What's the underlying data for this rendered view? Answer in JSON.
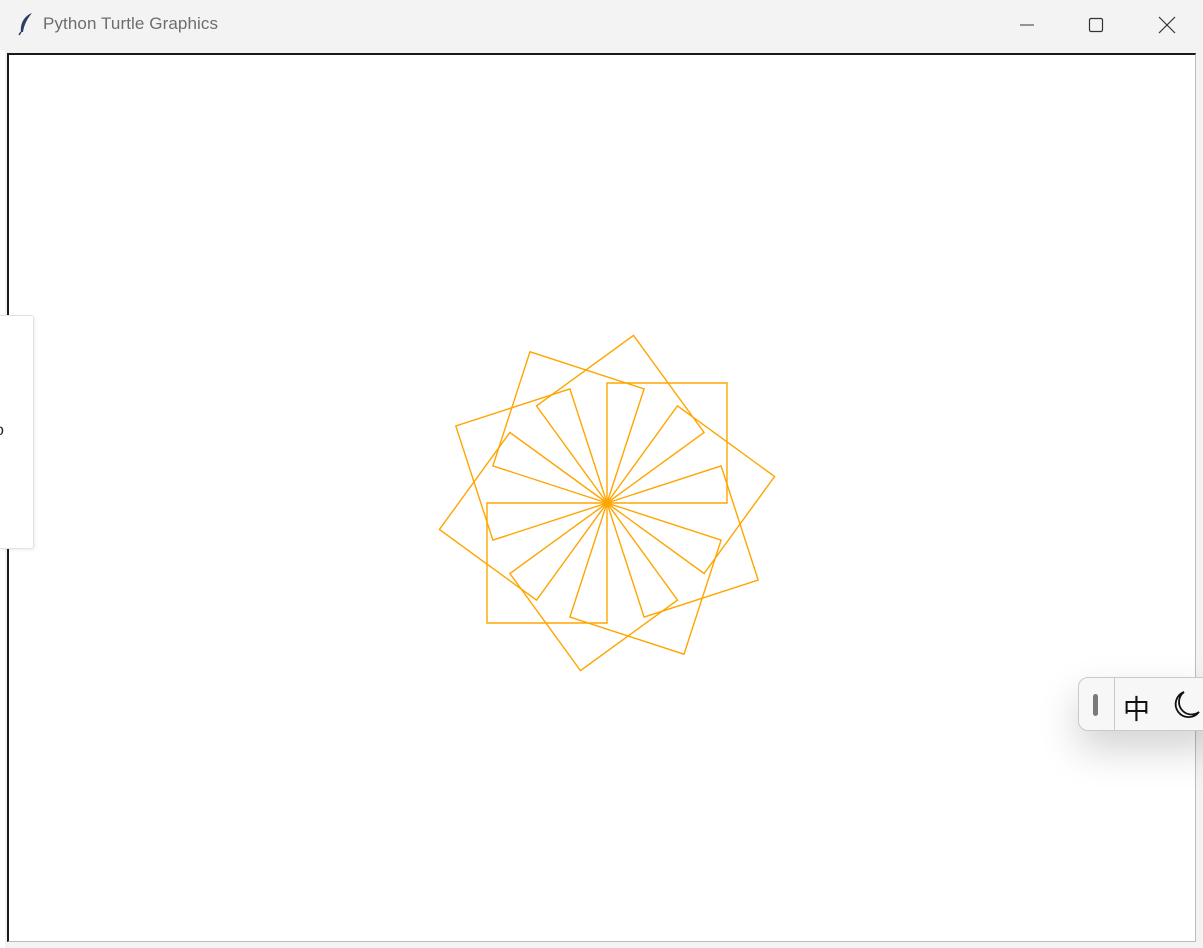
{
  "window": {
    "title": "Python Turtle Graphics",
    "app_icon": "feather-icon",
    "controls": {
      "minimize": "minimize-icon",
      "maximize": "maximize-icon",
      "close": "close-icon"
    }
  },
  "canvas": {
    "background": "#ffffff",
    "drawing": {
      "shape": "square",
      "square_count": 10,
      "rotation_step_degrees": 36,
      "side_length": 120,
      "stroke_color": "#ffa500"
    }
  },
  "side_panel": {
    "partial_glyph": "o"
  },
  "ime_toolbar": {
    "language_label": "中",
    "mode_icon": "crescent-moon-icon"
  }
}
